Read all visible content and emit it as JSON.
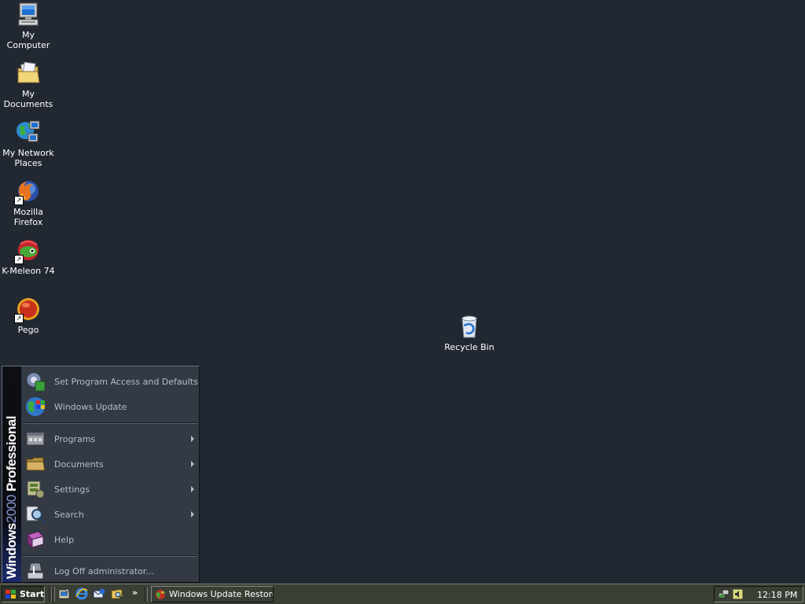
{
  "desktop": {
    "icons": [
      {
        "name": "my-computer",
        "label": "My Computer",
        "icon": "computer-icon"
      },
      {
        "name": "my-documents",
        "label": "My Documents",
        "icon": "folder-documents-icon"
      },
      {
        "name": "my-network-places",
        "label": "My Network Places",
        "icon": "network-icon"
      },
      {
        "name": "mozilla-firefox",
        "label": "Mozilla Firefox",
        "icon": "firefox-icon"
      },
      {
        "name": "k-meleon",
        "label": "K-Meleon 74",
        "icon": "k-meleon-icon"
      },
      {
        "name": "pego",
        "label": "Pego",
        "icon": "pego-icon"
      },
      {
        "name": "recycle-bin",
        "label": "Recycle Bin",
        "icon": "recycle-bin-icon"
      }
    ]
  },
  "start_menu": {
    "banner_bold": "Windows",
    "banner_light": "2000",
    "banner_edition": "Professional",
    "items": [
      {
        "label": "Set Program Access and Defaults",
        "icon": "program-access-icon",
        "submenu": false
      },
      {
        "label": "Windows Update",
        "icon": "windows-update-icon",
        "submenu": false
      },
      {
        "label": "Programs",
        "icon": "programs-icon",
        "submenu": true
      },
      {
        "label": "Documents",
        "icon": "documents-folder-icon",
        "submenu": true
      },
      {
        "label": "Settings",
        "icon": "settings-icon",
        "submenu": true
      },
      {
        "label": "Search",
        "icon": "search-icon",
        "submenu": true
      },
      {
        "label": "Help",
        "icon": "help-book-icon",
        "submenu": false
      },
      {
        "label": "Log Off administrator...",
        "icon": "log-off-icon",
        "submenu": false
      }
    ]
  },
  "taskbar": {
    "start_label": "Start",
    "quick_launch": [
      "show-desktop-icon",
      "internet-explorer-icon",
      "outlook-express-icon",
      "explorer-icon"
    ],
    "quick_launch_more": "»",
    "tasks": [
      {
        "label": "Windows Update Restore...",
        "icon": "windows-update-icon"
      }
    ],
    "tray": {
      "icons": [
        "network-tray-icon",
        "volume-tray-icon"
      ],
      "clock": "12:18 PM"
    }
  }
}
